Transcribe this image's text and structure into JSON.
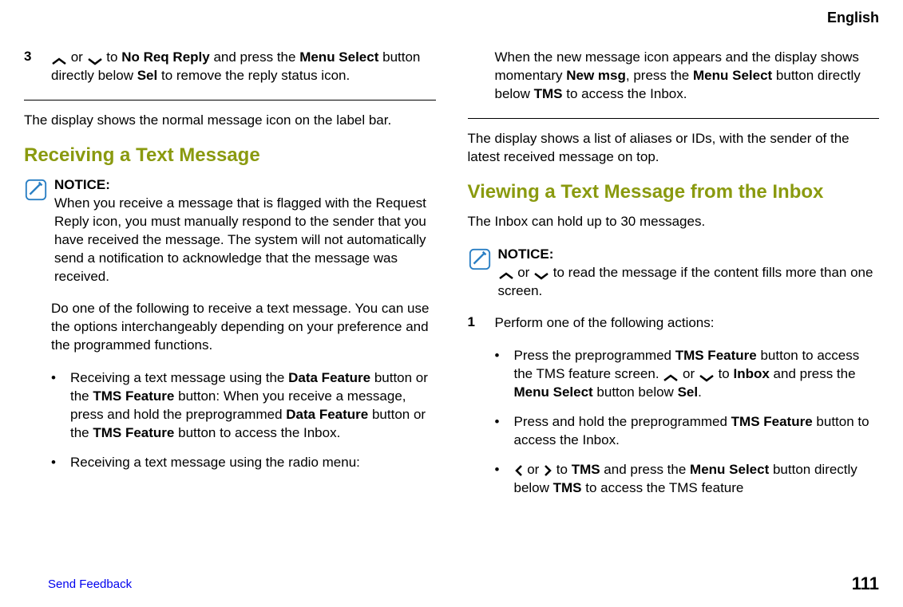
{
  "header": {
    "language": "English"
  },
  "left": {
    "step3_num": "3",
    "step3_part1": " or ",
    "step3_part2": " to ",
    "step3_noreq": "No Req Reply",
    "step3_part3": " and press the ",
    "step3_menu": "Menu Select",
    "step3_part4": " button directly below ",
    "step3_sel": "Sel",
    "step3_part5": " to remove the reply status icon.",
    "display_para": "The display shows the normal message icon on the label bar.",
    "heading1": "Receiving a Text Message",
    "notice_label": "NOTICE:",
    "notice_text": "When you receive a message that is flagged with the Request Reply icon, you must manually respond to the sender that you have received the message. The system will not automatically send a notification to acknowledge that the message was received.",
    "do_one": "Do one of the following to receive a text message. You can use the options interchangeably depending on your preference and the programmed functions.",
    "bullet1_a": "Receiving a text message using the ",
    "bullet1_b": "Data Feature",
    "bullet1_c": " button or the ",
    "bullet1_d": "TMS Feature",
    "bullet1_e": " button: When you receive a message, press and hold the preprogrammed ",
    "bullet1_f": "Data Feature",
    "bullet1_g": " button or the ",
    "bullet1_h": "TMS Feature",
    "bullet1_i": " button to access the Inbox.",
    "bullet2": "Receiving a text message using the radio menu:"
  },
  "right": {
    "top_part1": "When the new message icon appears and the display shows momentary ",
    "top_newmsg": "New msg",
    "top_part2": ", press the ",
    "top_menu": "Menu Select",
    "top_part3": " button directly below ",
    "top_tms": "TMS",
    "top_part4": " to access the Inbox.",
    "display_para": "The display shows a list of aliases or IDs, with the sender of the latest received message on top.",
    "heading2": "Viewing a Text Message from the Inbox",
    "inbox_para": "The Inbox can hold up to 30 messages.",
    "notice_label": "NOTICE:",
    "notice_part1": " or ",
    "notice_part2": " to read the message if the content fills more than one screen.",
    "step1_num": "1",
    "step1_text": "Perform one of the following actions:",
    "b1_a": "Press the preprogrammed ",
    "b1_b": "TMS Feature",
    "b1_c": " button to access the TMS feature screen. ",
    "b1_d": " or ",
    "b1_e": " to ",
    "b1_inbox": "Inbox",
    "b1_f": " and press the ",
    "b1_menu": "Menu Select",
    "b1_g": " button below ",
    "b1_sel": "Sel",
    "b1_h": ".",
    "b2_a": "Press and hold the preprogrammed ",
    "b2_b": "TMS Feature",
    "b2_c": " button to access the Inbox.",
    "b3_a": " or ",
    "b3_b": " to ",
    "b3_tms1": "TMS",
    "b3_c": " and press the ",
    "b3_menu": "Menu Select",
    "b3_d": " button directly below ",
    "b3_tms2": "TMS",
    "b3_e": " to access the TMS feature"
  },
  "footer": {
    "feedback": "Send Feedback",
    "page": "111"
  }
}
